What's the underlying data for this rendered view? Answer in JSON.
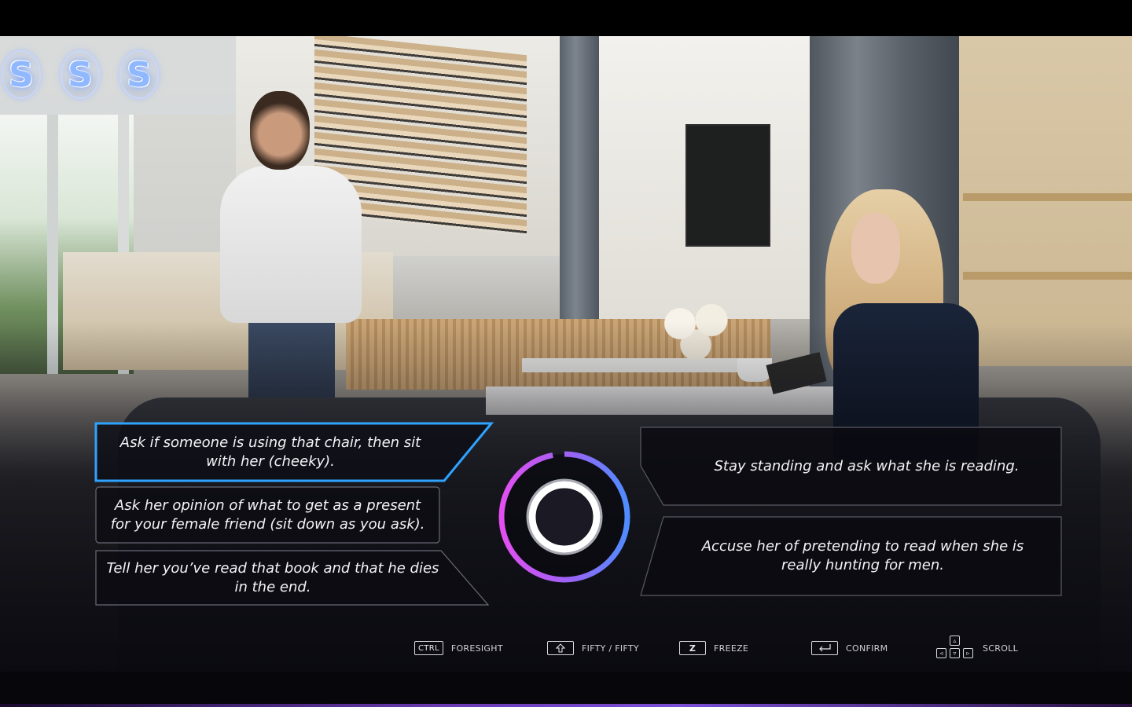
{
  "lifelines": [
    {
      "label": "S",
      "icon": "s-lifeline-icon"
    },
    {
      "label": "S",
      "icon": "s-lifeline-icon"
    },
    {
      "label": "S",
      "icon": "s-lifeline-icon"
    }
  ],
  "choices_left": [
    {
      "text": "Ask if someone is using that chair, then sit with her (cheeky).",
      "selected": true
    },
    {
      "text": "Ask her opinion of what to get as a present for your female friend (sit down as you ask).",
      "selected": false
    },
    {
      "text": "Tell her you’ve read that book and that he dies in the end.",
      "selected": false
    }
  ],
  "choices_right": [
    {
      "text": "Stay standing and ask what she is reading.",
      "selected": false
    },
    {
      "text": "Accuse her of pretending to read when she is really hunting for men.",
      "selected": false
    }
  ],
  "timer": {
    "remaining_fraction": 0.97,
    "colors": {
      "start": "#e34ff0",
      "end": "#4f8dff"
    }
  },
  "controls": [
    {
      "key": "CTRL",
      "label": "FORESIGHT"
    },
    {
      "key": "shift-arrow-icon",
      "label": "FIFTY / FIFTY"
    },
    {
      "key": "Z",
      "label": "FREEZE"
    },
    {
      "key": "enter-arrow-icon",
      "label": "CONFIRM"
    },
    {
      "key": "arrow-keys-icon",
      "label": "SCROLL"
    }
  ],
  "colors": {
    "selected_outline": "#2ea3ff",
    "panel_border": "#5a5a66",
    "panel_fill": "#0d0d12"
  }
}
